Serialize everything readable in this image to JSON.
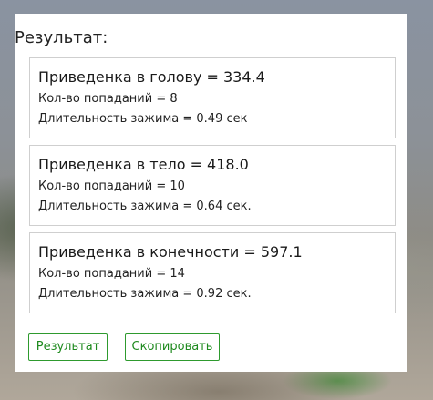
{
  "panel": {
    "title": "Результат:"
  },
  "cards": [
    {
      "heading": "Приведенка в голову = 334.4",
      "hits": "Кол-во попаданий = 8",
      "duration": "Длительность зажима = 0.49 сек"
    },
    {
      "heading": "Приведенка в тело = 418.0",
      "hits": "Кол-во попаданий = 10",
      "duration": "Длительность зажима = 0.64 сек."
    },
    {
      "heading": "Приведенка в конечности = 597.1",
      "hits": "Кол-во попаданий = 14",
      "duration": "Длительность зажима = 0.92 сек."
    }
  ],
  "buttons": {
    "result_label": "Результат",
    "copy_label": "Скопировать"
  },
  "colors": {
    "accent": "#2e9a2e",
    "panel_bg": "#ffffff",
    "card_border": "#cfcfcf"
  }
}
